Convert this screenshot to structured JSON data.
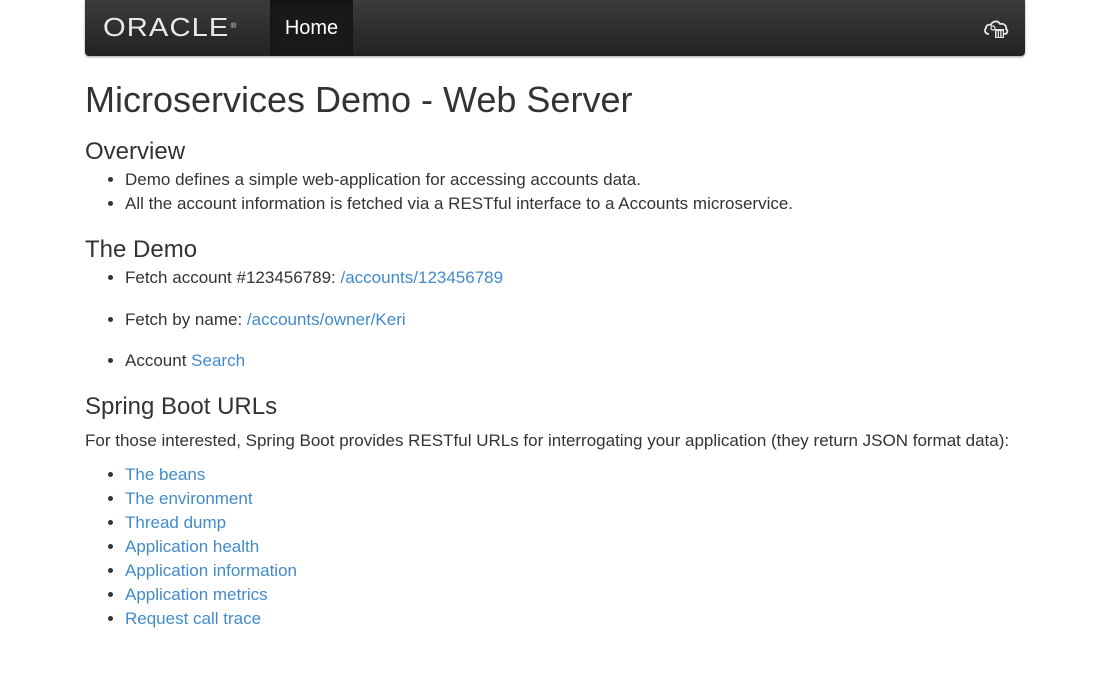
{
  "navbar": {
    "brand": "ORACLE",
    "brand_mark": "®",
    "home_label": "Home",
    "right_icon": "cloud-app-icon"
  },
  "page": {
    "title": "Microservices Demo - Web Server"
  },
  "overview": {
    "heading": "Overview",
    "items": [
      "Demo defines a simple web-application for accessing accounts data.",
      "All the account information is fetched via a RESTful interface to a Accounts microservice."
    ]
  },
  "demo": {
    "heading": "The Demo",
    "items": [
      {
        "text": "Fetch account #123456789: ",
        "link": "/accounts/123456789"
      },
      {
        "text": "Fetch by name: ",
        "link": "/accounts/owner/Keri"
      },
      {
        "text": "Account ",
        "link": "Search"
      }
    ]
  },
  "spring": {
    "heading": "Spring Boot URLs",
    "intro": "For those interested, Spring Boot provides RESTful URLs for interrogating your application (they return JSON format data):",
    "links": [
      "The beans",
      "The environment",
      "Thread dump",
      "Application health",
      "Application information",
      "Application metrics",
      "Request call trace"
    ]
  },
  "colors": {
    "link": "#428bca",
    "navbar": "#222222",
    "text": "#333333"
  }
}
